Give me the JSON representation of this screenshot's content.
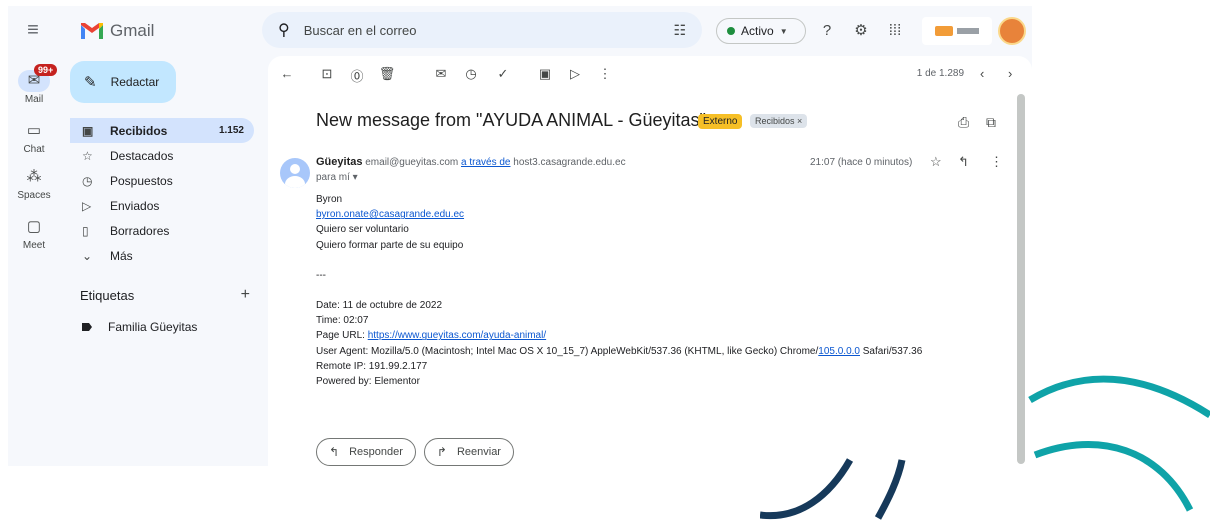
{
  "rail": {
    "mail_label": "Mail",
    "mail_badge": "99+",
    "chat_label": "Chat",
    "spaces_label": "Spaces",
    "meet_label": "Meet"
  },
  "header": {
    "app_name": "Gmail",
    "search_placeholder": "Buscar en el correo",
    "status": "Activo",
    "status_color": "#1e8e3e"
  },
  "compose": {
    "label": "Redactar"
  },
  "nav": {
    "items": [
      {
        "label": "Recibidos",
        "count": "1.152",
        "icon": "inbox-icon"
      },
      {
        "label": "Destacados",
        "icon": "star-icon"
      },
      {
        "label": "Pospuestos",
        "icon": "clock-icon"
      },
      {
        "label": "Enviados",
        "icon": "send-icon"
      },
      {
        "label": "Borradores",
        "icon": "draft-icon"
      },
      {
        "label": "Más",
        "icon": "chevron-down-icon"
      }
    ],
    "labels_title": "Etiquetas",
    "label_items": [
      "Familia Güeyitas"
    ]
  },
  "toolbar": {
    "pager": "1 de 1.289"
  },
  "message": {
    "subject": "New message from \"AYUDA ANIMAL - Güeyitas\"",
    "tag_external": "Externo",
    "tag_inbox": "Recibidos ×",
    "sender_name": "Güeyitas",
    "sender_email": "email@gueyitas.com",
    "via_text": "a través de",
    "via_host": "host3.casagrande.edu.ec",
    "to": "para mí ▾",
    "time": "21:07 (hace 0 minutos)",
    "body": {
      "name": "Byron",
      "email": "byron.onate@casagrande.edu.ec",
      "line1": "Quiero ser voluntario",
      "line2": "Quiero formar parte de su equipo",
      "separator": "---",
      "date": "Date: 11 de octubre de 2022",
      "time": "Time: 02:07",
      "page_url_label": "Page URL: ",
      "page_url": "https://www.gueyitas.com/ayuda-animal/",
      "ua_pre": "User Agent: Mozilla/5.0 (Macintosh; Intel Mac OS X 10_15_7) AppleWebKit/537.36 (KHTML, like Gecko) Chrome/",
      "ua_version": "105.0.0.0",
      "ua_post": " Safari/537.36",
      "remote_ip": "Remote IP: 191.99.2.177",
      "powered_by": "Powered by: Elementor"
    },
    "reply_label": "Responder",
    "forward_label": "Reenviar"
  },
  "colors": {
    "accent": "#c2e7ff",
    "selected": "#d3e3fd",
    "external_tag": "#f6bf26",
    "wave": "#0fa3a8"
  }
}
